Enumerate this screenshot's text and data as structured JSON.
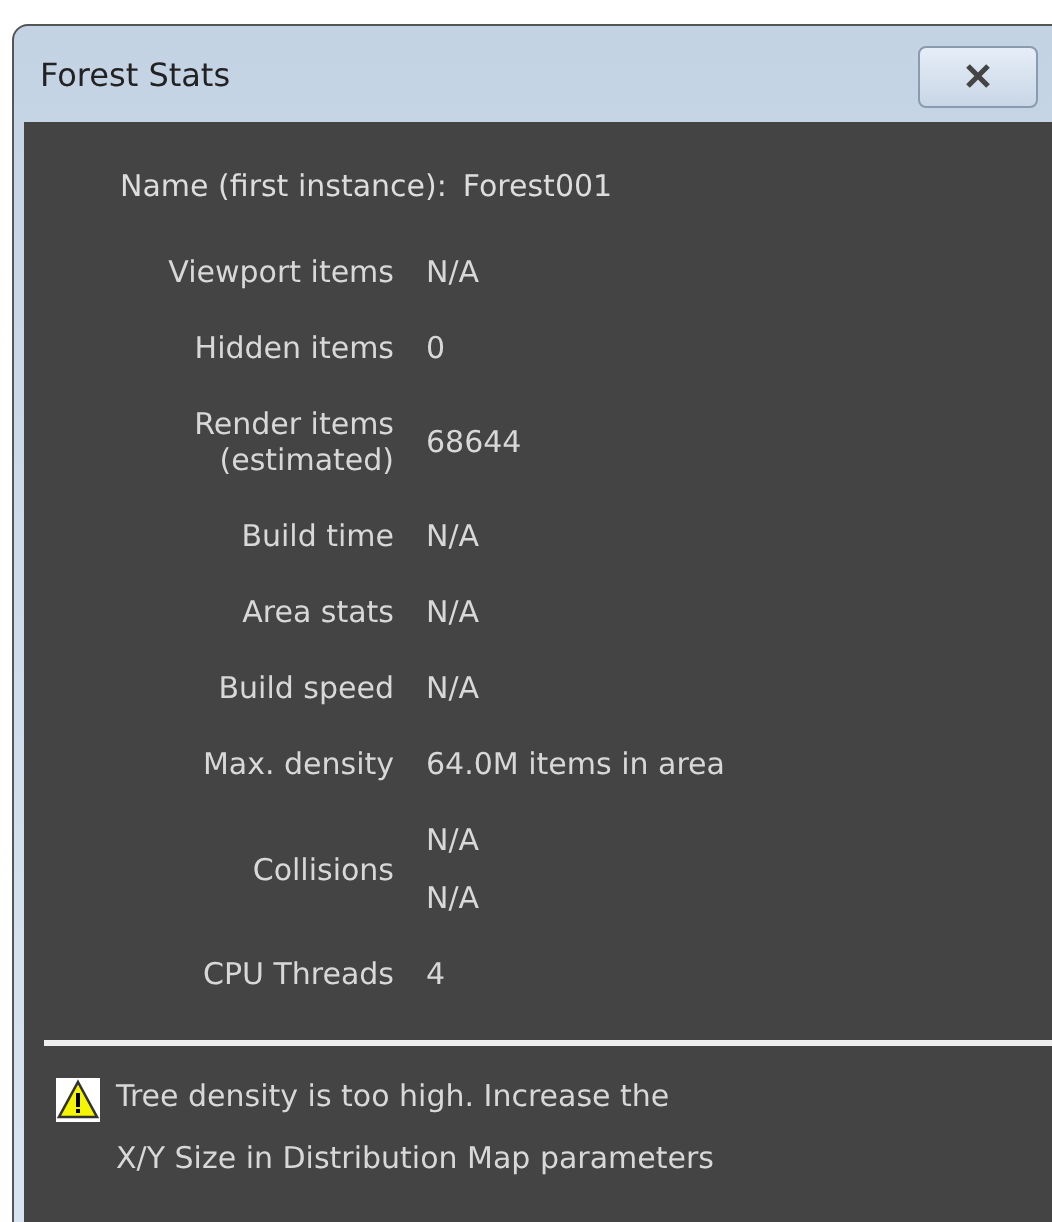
{
  "window": {
    "title": "Forest Stats"
  },
  "name_line": {
    "label": "Name (first instance):",
    "value": "Forest001"
  },
  "stats": [
    {
      "label": "Viewport items",
      "values": [
        "N/A"
      ]
    },
    {
      "label": "Hidden items",
      "values": [
        "0"
      ]
    },
    {
      "label": "Render items\n(estimated)",
      "values": [
        "68644"
      ]
    },
    {
      "label": "Build time",
      "values": [
        "N/A"
      ]
    },
    {
      "label": "Area stats",
      "values": [
        "N/A"
      ]
    },
    {
      "label": "Build speed",
      "values": [
        "N/A"
      ]
    },
    {
      "label": "Max. density",
      "values": [
        "64.0M items in area"
      ]
    },
    {
      "label": "Collisions",
      "values": [
        "N/A",
        "N/A"
      ]
    },
    {
      "label": "CPU Threads",
      "values": [
        "4"
      ]
    }
  ],
  "warning": {
    "kind": "warning",
    "text": "Tree density is too high. Increase the\nX/Y Size in Distribution Map parameters"
  }
}
